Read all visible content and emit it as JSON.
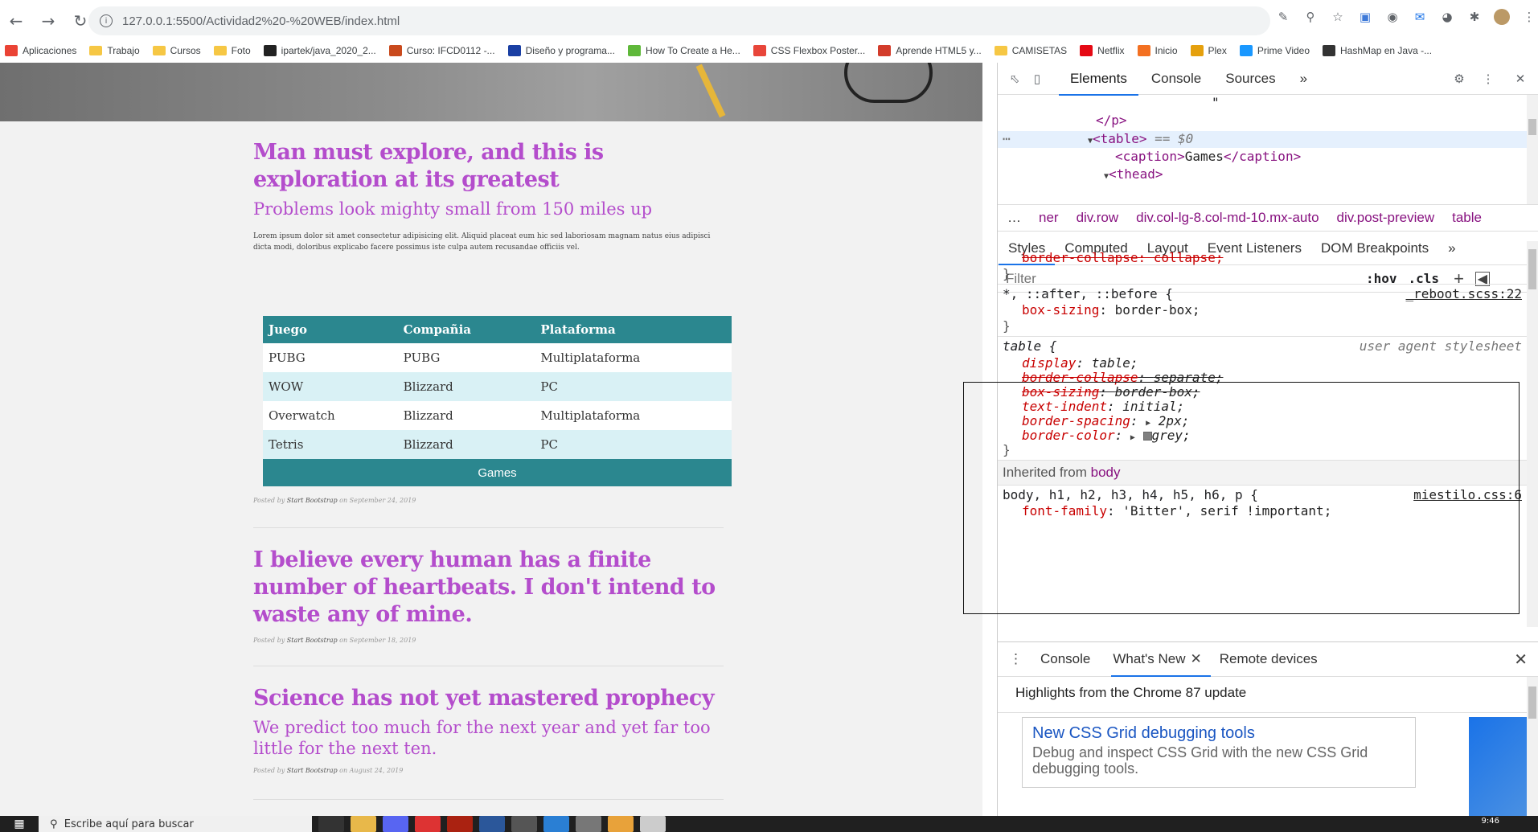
{
  "browser": {
    "url": "127.0.0.1:5500/Actividad2%20-%20WEB/index.html",
    "bookmarks": [
      {
        "label": "Aplicaciones",
        "icon": "apps-icon",
        "color": "#ea4335"
      },
      {
        "label": "Trabajo",
        "icon": "folder-icon",
        "color": "#f6c744"
      },
      {
        "label": "Cursos",
        "icon": "folder-icon",
        "color": "#f6c744"
      },
      {
        "label": "Foto",
        "icon": "folder-icon",
        "color": "#f6c744"
      },
      {
        "label": "ipartek/java_2020_2...",
        "icon": "github-icon",
        "color": "#222222"
      },
      {
        "label": "Curso: IFCD0112 -...",
        "icon": "course-icon",
        "color": "#c94a1d"
      },
      {
        "label": "Diseño y programa...",
        "icon": "diamond-icon",
        "color": "#1a3fa3"
      },
      {
        "label": "How To Create a He...",
        "icon": "site-icon",
        "color": "#5fb83a"
      },
      {
        "label": "CSS Flexbox Poster...",
        "icon": "css-tricks-icon",
        "color": "#e8463a"
      },
      {
        "label": "Aprende HTML5 y...",
        "icon": "site-icon",
        "color": "#d33c2b"
      },
      {
        "label": "CAMISETAS",
        "icon": "folder-icon",
        "color": "#f6c744"
      },
      {
        "label": "Netflix",
        "icon": "netflix-icon",
        "color": "#e50914"
      },
      {
        "label": "Inicio",
        "icon": "site-icon",
        "color": "#f37021"
      },
      {
        "label": "Plex",
        "icon": "plex-icon",
        "color": "#e5a00d"
      },
      {
        "label": "Prime Video",
        "icon": "prime-icon",
        "color": "#1a98ff"
      },
      {
        "label": "HashMap en Java -...",
        "icon": "java-icon",
        "color": "#333333"
      }
    ]
  },
  "page": {
    "posts": [
      {
        "title": "Man must explore, and this is exploration at its greatest",
        "subtitle": "Problems look mighty small from 150 miles up",
        "body": "Lorem ipsum dolor sit amet consectetur adipisicing elit. Aliquid placeat eum hic sed laboriosam magnam natus eius adipisci dicta modi, doloribus explicabo facere possimus iste culpa autem recusandae officiis vel.",
        "meta_prefix": "Posted by",
        "author": "Start Bootstrap",
        "date": "on September 24, 2019"
      },
      {
        "title": "I believe every human has a finite number of heartbeats. I don't intend to waste any of mine.",
        "meta_prefix": "Posted by",
        "author": "Start Bootstrap",
        "date": "on September 18, 2019"
      },
      {
        "title": "Science has not yet mastered prophecy",
        "subtitle": "We predict too much for the next year and yet far too little for the next ten.",
        "meta_prefix": "Posted by",
        "author": "Start Bootstrap",
        "date": "on August 24, 2019"
      }
    ],
    "table": {
      "headers": [
        "Juego",
        "Compañia",
        "Plataforma"
      ],
      "rows": [
        [
          "PUBG",
          "PUBG",
          "Multiplataforma"
        ],
        [
          "WOW",
          "Blizzard",
          "PC"
        ],
        [
          "Overwatch",
          "Blizzard",
          "Multiplataforma"
        ],
        [
          "Tetris",
          "Blizzard",
          "PC"
        ]
      ],
      "caption": "Games",
      "header_color": "#2b878f",
      "stripe_color": "#d9f1f5"
    },
    "accent_color": "#b44dcc"
  },
  "devtools": {
    "tabs": [
      "Elements",
      "Console",
      "Sources"
    ],
    "dom": {
      "quote": "\"",
      "close_p": "</p>",
      "table_open": "<table>",
      "selected_marker": "== $0",
      "caption_open": "<caption>",
      "caption_text": "Games",
      "caption_close": "</caption>",
      "thead_open": "<thead>"
    },
    "breadcrumbs": [
      "ner",
      "div.row",
      "div.col-lg-8.col-md-10.mx-auto",
      "div.post-preview",
      "table"
    ],
    "subtabs": [
      "Styles",
      "Computed",
      "Layout",
      "Event Listeners",
      "DOM Breakpoints"
    ],
    "filter_placeholder": "Filter",
    "hov": ":hov",
    "cls": ".cls",
    "styles": {
      "partial_prop": "border-collapse: collapse;",
      "reboot_selector": "*, ::after, ::before {",
      "reboot_source": "_reboot.scss:22",
      "reboot_prop": "box-sizing",
      "reboot_val": "border-box;",
      "ua_selector": "table {",
      "ua_source": "user agent stylesheet",
      "ua_props": [
        {
          "name": "display",
          "value": "table;",
          "struck": false
        },
        {
          "name": "border-collapse",
          "value": "separate;",
          "struck": true
        },
        {
          "name": "box-sizing",
          "value": "border-box;",
          "struck": true
        },
        {
          "name": "text-indent",
          "value": "initial;",
          "struck": false
        },
        {
          "name": "border-spacing",
          "value": "2px;",
          "struck": false
        },
        {
          "name": "border-color",
          "value": "grey;",
          "struck": false
        }
      ],
      "inherited_label": "Inherited from",
      "inherited_from": "body",
      "body_selector": "body, h1, h2, h3, h4, h5, h6, p {",
      "body_source": "miestilo.css:6",
      "body_prop": "font-family",
      "body_val": "'Bitter', serif !important;"
    },
    "drawer": {
      "tabs": [
        "Console",
        "What's New",
        "Remote devices"
      ],
      "headline": "Highlights from the Chrome 87 update",
      "card_title": "New CSS Grid debugging tools",
      "card_body": "Debug and inspect CSS Grid with the new CSS Grid debugging tools."
    }
  },
  "taskbar": {
    "search_placeholder": "Escribe aquí para buscar",
    "time": "9:46"
  }
}
